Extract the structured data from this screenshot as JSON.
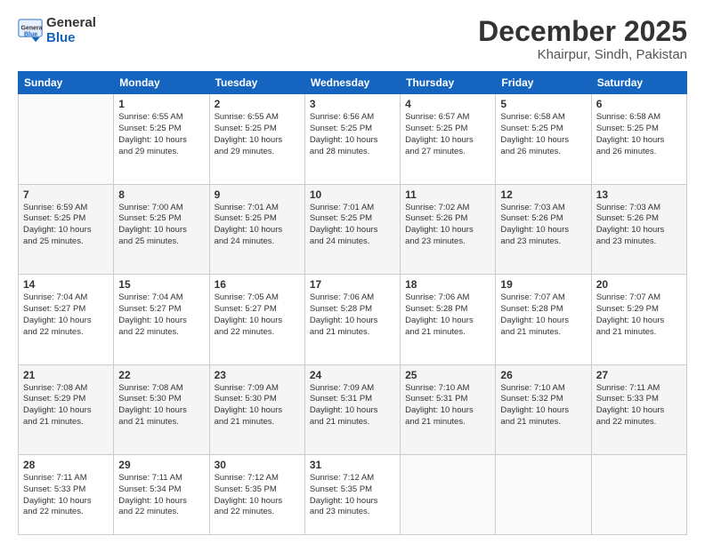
{
  "logo": {
    "general": "General",
    "blue": "Blue"
  },
  "header": {
    "month": "December 2025",
    "location": "Khairpur, Sindh, Pakistan"
  },
  "weekdays": [
    "Sunday",
    "Monday",
    "Tuesday",
    "Wednesday",
    "Thursday",
    "Friday",
    "Saturday"
  ],
  "weeks": [
    [
      {
        "day": "",
        "info": ""
      },
      {
        "day": "1",
        "info": "Sunrise: 6:55 AM\nSunset: 5:25 PM\nDaylight: 10 hours\nand 29 minutes."
      },
      {
        "day": "2",
        "info": "Sunrise: 6:55 AM\nSunset: 5:25 PM\nDaylight: 10 hours\nand 29 minutes."
      },
      {
        "day": "3",
        "info": "Sunrise: 6:56 AM\nSunset: 5:25 PM\nDaylight: 10 hours\nand 28 minutes."
      },
      {
        "day": "4",
        "info": "Sunrise: 6:57 AM\nSunset: 5:25 PM\nDaylight: 10 hours\nand 27 minutes."
      },
      {
        "day": "5",
        "info": "Sunrise: 6:58 AM\nSunset: 5:25 PM\nDaylight: 10 hours\nand 26 minutes."
      },
      {
        "day": "6",
        "info": "Sunrise: 6:58 AM\nSunset: 5:25 PM\nDaylight: 10 hours\nand 26 minutes."
      }
    ],
    [
      {
        "day": "7",
        "info": "Sunrise: 6:59 AM\nSunset: 5:25 PM\nDaylight: 10 hours\nand 25 minutes."
      },
      {
        "day": "8",
        "info": "Sunrise: 7:00 AM\nSunset: 5:25 PM\nDaylight: 10 hours\nand 25 minutes."
      },
      {
        "day": "9",
        "info": "Sunrise: 7:01 AM\nSunset: 5:25 PM\nDaylight: 10 hours\nand 24 minutes."
      },
      {
        "day": "10",
        "info": "Sunrise: 7:01 AM\nSunset: 5:25 PM\nDaylight: 10 hours\nand 24 minutes."
      },
      {
        "day": "11",
        "info": "Sunrise: 7:02 AM\nSunset: 5:26 PM\nDaylight: 10 hours\nand 23 minutes."
      },
      {
        "day": "12",
        "info": "Sunrise: 7:03 AM\nSunset: 5:26 PM\nDaylight: 10 hours\nand 23 minutes."
      },
      {
        "day": "13",
        "info": "Sunrise: 7:03 AM\nSunset: 5:26 PM\nDaylight: 10 hours\nand 23 minutes."
      }
    ],
    [
      {
        "day": "14",
        "info": "Sunrise: 7:04 AM\nSunset: 5:27 PM\nDaylight: 10 hours\nand 22 minutes."
      },
      {
        "day": "15",
        "info": "Sunrise: 7:04 AM\nSunset: 5:27 PM\nDaylight: 10 hours\nand 22 minutes."
      },
      {
        "day": "16",
        "info": "Sunrise: 7:05 AM\nSunset: 5:27 PM\nDaylight: 10 hours\nand 22 minutes."
      },
      {
        "day": "17",
        "info": "Sunrise: 7:06 AM\nSunset: 5:28 PM\nDaylight: 10 hours\nand 21 minutes."
      },
      {
        "day": "18",
        "info": "Sunrise: 7:06 AM\nSunset: 5:28 PM\nDaylight: 10 hours\nand 21 minutes."
      },
      {
        "day": "19",
        "info": "Sunrise: 7:07 AM\nSunset: 5:28 PM\nDaylight: 10 hours\nand 21 minutes."
      },
      {
        "day": "20",
        "info": "Sunrise: 7:07 AM\nSunset: 5:29 PM\nDaylight: 10 hours\nand 21 minutes."
      }
    ],
    [
      {
        "day": "21",
        "info": "Sunrise: 7:08 AM\nSunset: 5:29 PM\nDaylight: 10 hours\nand 21 minutes."
      },
      {
        "day": "22",
        "info": "Sunrise: 7:08 AM\nSunset: 5:30 PM\nDaylight: 10 hours\nand 21 minutes."
      },
      {
        "day": "23",
        "info": "Sunrise: 7:09 AM\nSunset: 5:30 PM\nDaylight: 10 hours\nand 21 minutes."
      },
      {
        "day": "24",
        "info": "Sunrise: 7:09 AM\nSunset: 5:31 PM\nDaylight: 10 hours\nand 21 minutes."
      },
      {
        "day": "25",
        "info": "Sunrise: 7:10 AM\nSunset: 5:31 PM\nDaylight: 10 hours\nand 21 minutes."
      },
      {
        "day": "26",
        "info": "Sunrise: 7:10 AM\nSunset: 5:32 PM\nDaylight: 10 hours\nand 21 minutes."
      },
      {
        "day": "27",
        "info": "Sunrise: 7:11 AM\nSunset: 5:33 PM\nDaylight: 10 hours\nand 22 minutes."
      }
    ],
    [
      {
        "day": "28",
        "info": "Sunrise: 7:11 AM\nSunset: 5:33 PM\nDaylight: 10 hours\nand 22 minutes."
      },
      {
        "day": "29",
        "info": "Sunrise: 7:11 AM\nSunset: 5:34 PM\nDaylight: 10 hours\nand 22 minutes."
      },
      {
        "day": "30",
        "info": "Sunrise: 7:12 AM\nSunset: 5:35 PM\nDaylight: 10 hours\nand 22 minutes."
      },
      {
        "day": "31",
        "info": "Sunrise: 7:12 AM\nSunset: 5:35 PM\nDaylight: 10 hours\nand 23 minutes."
      },
      {
        "day": "",
        "info": ""
      },
      {
        "day": "",
        "info": ""
      },
      {
        "day": "",
        "info": ""
      }
    ]
  ]
}
